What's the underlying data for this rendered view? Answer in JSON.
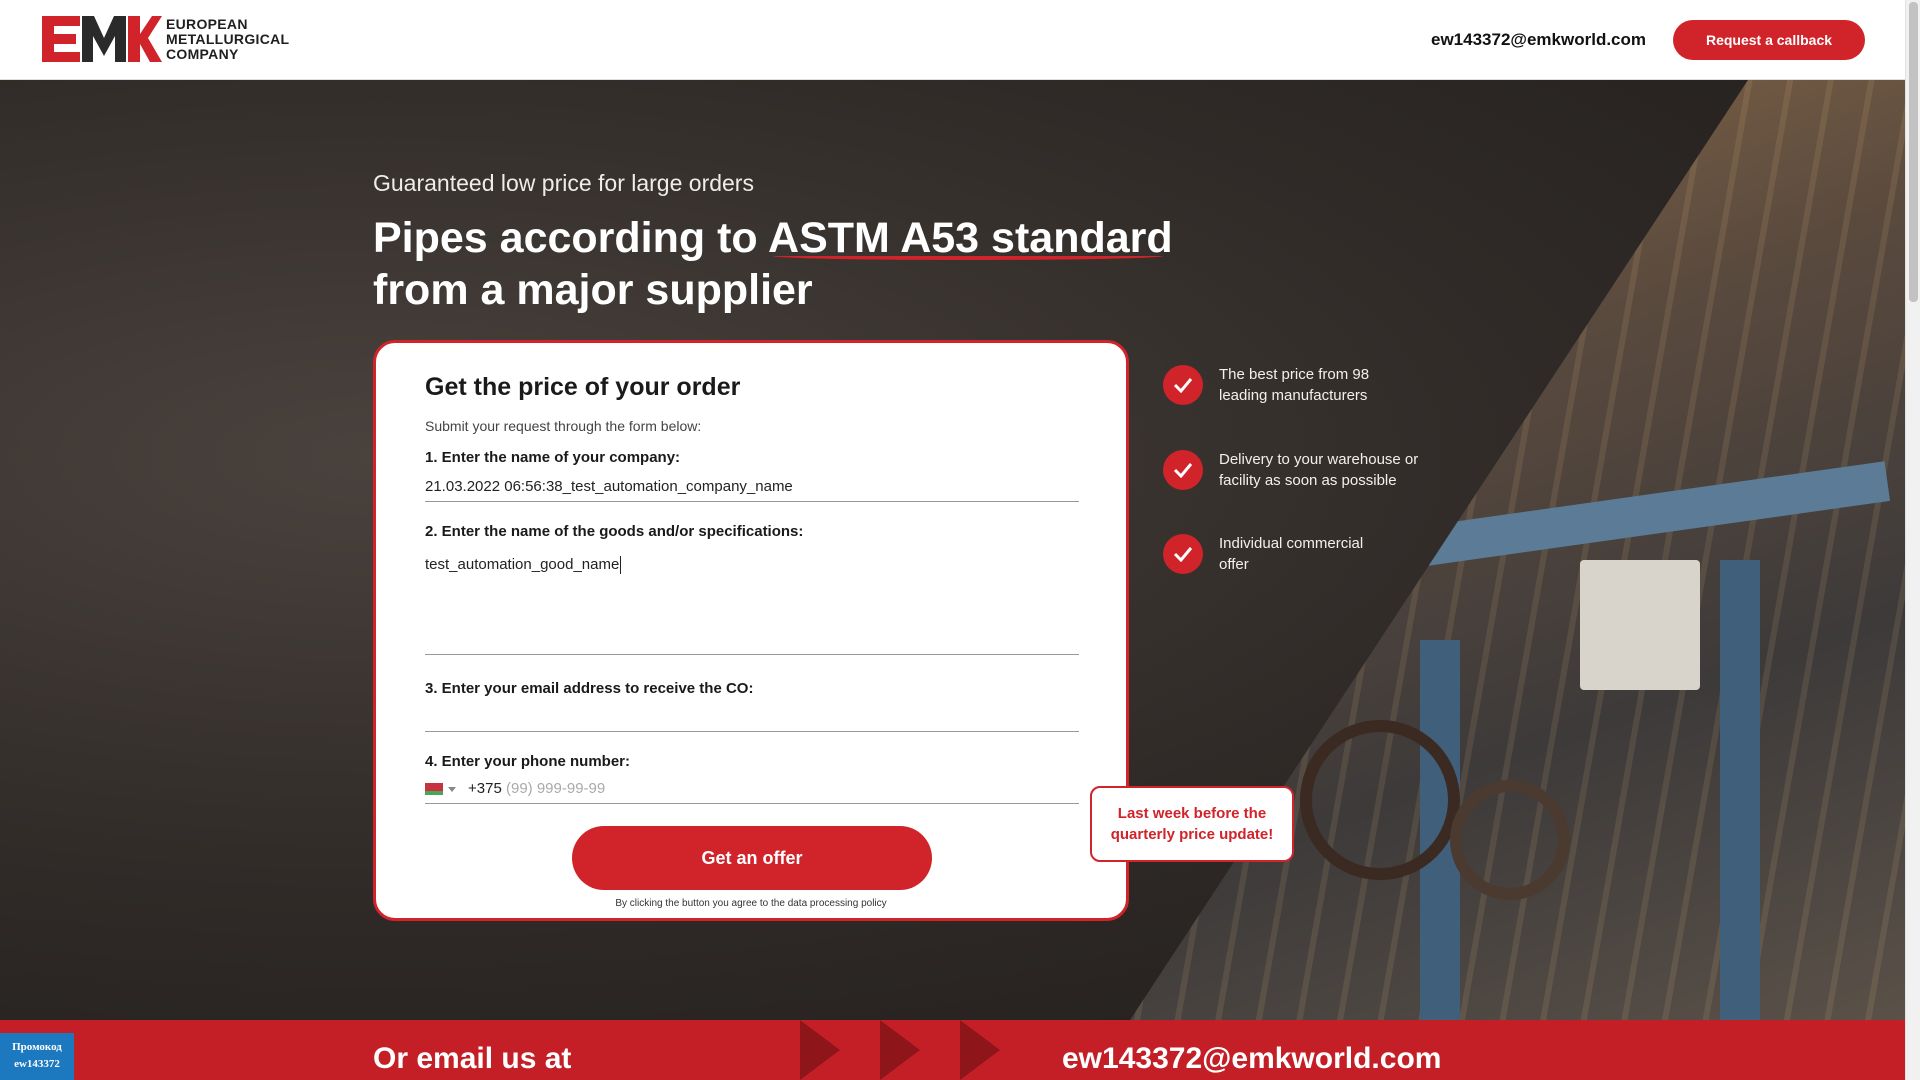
{
  "header": {
    "logo_lines": [
      "EUROPEAN",
      "METALLURGICAL",
      "COMPANY"
    ],
    "logo_letters": "EMK",
    "email": "ew143372@emkworld.com",
    "callback_label": "Request a callback"
  },
  "hero": {
    "subtitle": "Guaranteed low price for large orders",
    "headline_line1": "Pipes according to ASTM A53 standard",
    "headline_line2": "from a major supplier"
  },
  "form": {
    "title": "Get the price of your order",
    "subtitle": "Submit your request through the form below:",
    "company_label": "1. Enter the name of your company:",
    "company_value": "21.03.2022 06:56:38_test_automation_company_name",
    "goods_label": "2. Enter the name of the goods and/or specifications:",
    "goods_value": "test_automation_good_name",
    "email_label": "3. Enter your email address to receive the CO:",
    "email_value": "",
    "phone_label": "4. Enter your phone number:",
    "phone_code": "+375",
    "phone_placeholder": "(99) 999-99-99",
    "submit_label": "Get an offer",
    "policy_text": "By clicking the button you agree to the data processing policy"
  },
  "benefits": [
    {
      "line1": "The best price from 98",
      "line2": "leading manufacturers"
    },
    {
      "line1": "Delivery to your warehouse or",
      "line2": "facility as soon as possible"
    },
    {
      "line1": "Individual commercial",
      "line2": "offer"
    }
  ],
  "callout": {
    "line1": "Last week before the",
    "line2": "quarterly price update!"
  },
  "band": {
    "left_text": "Or email us at",
    "right_text": "ew143372@emkworld.com"
  },
  "promo": {
    "line1": "Промокод",
    "line2": "ew143372"
  },
  "colors": {
    "brand_red": "#d0232a",
    "promo_blue": "#1c79c0"
  }
}
